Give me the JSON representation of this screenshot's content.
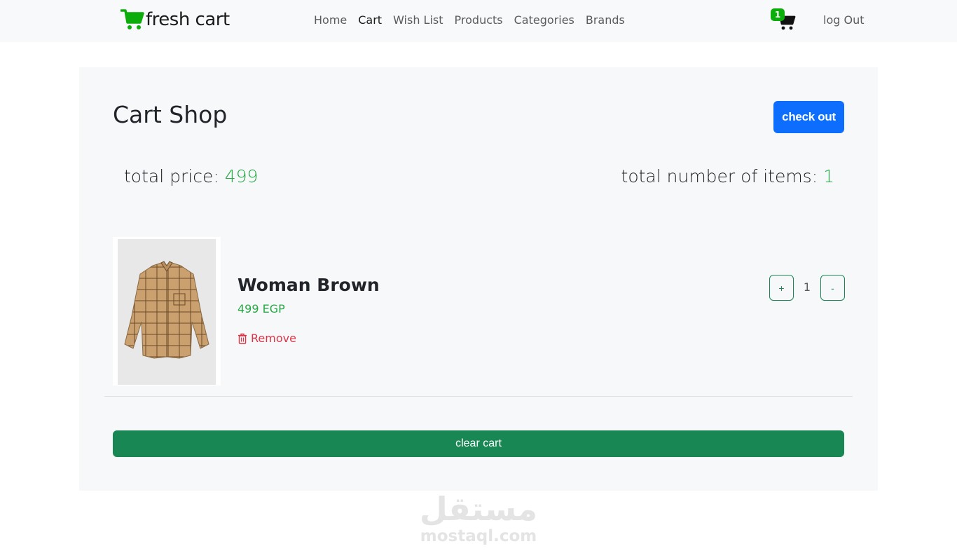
{
  "navbar": {
    "brand": "fresh cart",
    "links": [
      {
        "label": "Home",
        "active": false
      },
      {
        "label": "Cart",
        "active": true
      },
      {
        "label": "Wish List",
        "active": false
      },
      {
        "label": "Products",
        "active": false
      },
      {
        "label": "Categories",
        "active": false
      },
      {
        "label": "Brands",
        "active": false
      }
    ],
    "cart_count": "1",
    "logout_label": "log Out"
  },
  "cart": {
    "title": "Cart Shop",
    "checkout_label": "check out",
    "total_price_label": "total price: ",
    "total_price_value": "499",
    "total_items_label": "total number of items: ",
    "total_items_value": "1",
    "items": [
      {
        "name": "Woman Brown",
        "price": "499 EGP",
        "remove_label": "Remove",
        "quantity": "1",
        "plus_label": "+",
        "minus_label": "-"
      }
    ],
    "clear_label": "clear cart"
  },
  "watermark": {
    "arabic": "مستقل",
    "latin": "mostaql.com"
  },
  "colors": {
    "brand_green": "#0aad0a",
    "price_green": "#28a745",
    "primary_blue": "#0d6efd",
    "success_green": "#198754",
    "danger_red": "#dc3545"
  }
}
